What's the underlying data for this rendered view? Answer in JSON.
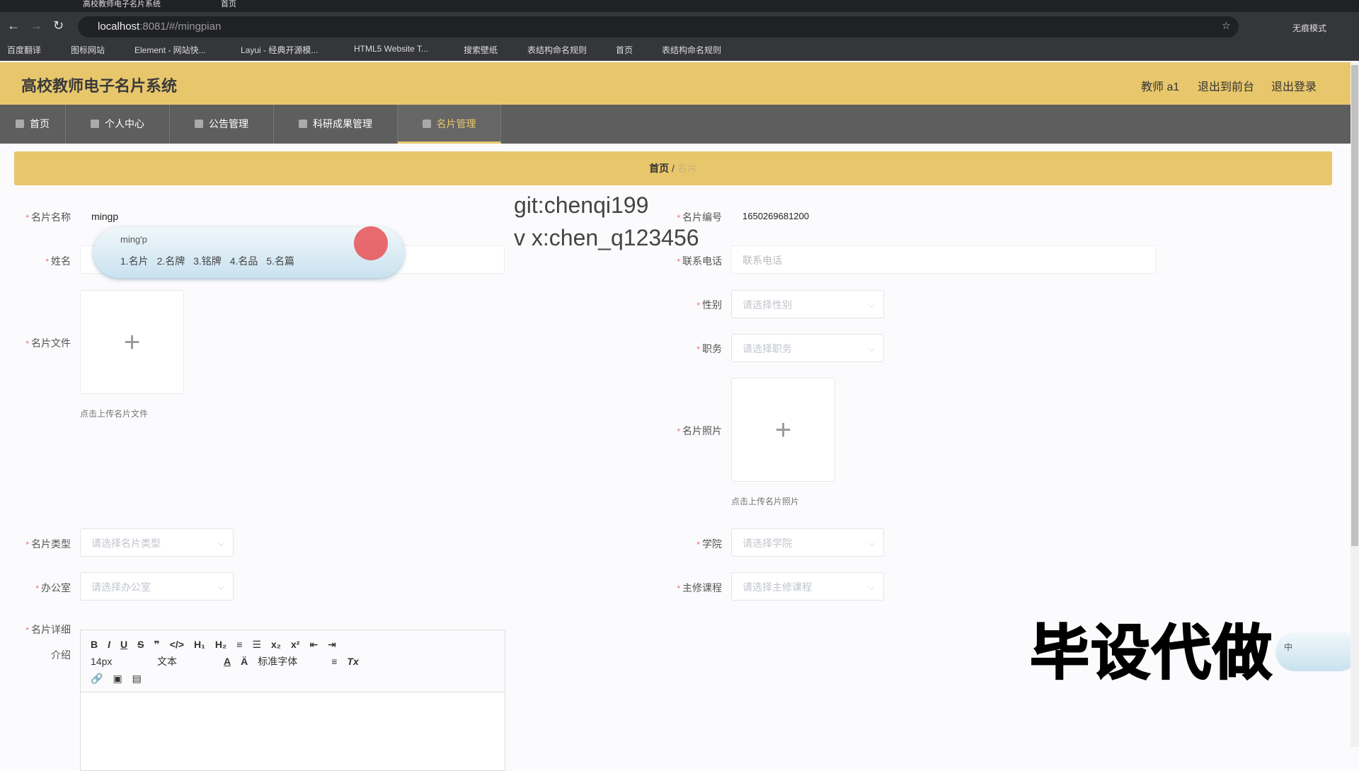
{
  "browser": {
    "tabs": [
      "高校教师电子名片系统",
      "首页"
    ],
    "url_host": "localhost",
    "url_rest": ":8081/#/mingpian",
    "profile": "无痕模式",
    "bookmarks": [
      "百度翻译",
      "图标网站",
      "Element - 网站快...",
      "Layui - 经典开源模...",
      "HTML5 Website T...",
      "搜索壁纸",
      "表结构命名规则",
      "首页",
      "表结构命名规则"
    ]
  },
  "header": {
    "title": "高校教师电子名片系统",
    "user": "教师 a1",
    "to_front": "退出到前台",
    "logout": "退出登录"
  },
  "nav": [
    "首页",
    "个人中心",
    "公告管理",
    "科研成果管理",
    "名片管理"
  ],
  "breadcrumb": {
    "home": "首页",
    "sep": "/",
    "current": "名片"
  },
  "form": {
    "name_label": "名片名称",
    "name_value": "mingp",
    "xingming_label": "姓名",
    "file_label": "名片文件",
    "file_hint": "点击上传名片文件",
    "type_label": "名片类型",
    "type_ph": "请选择名片类型",
    "office_label": "办公室",
    "office_ph": "请选择办公室",
    "detail_label": "名片详细",
    "detail_label2": "介绍",
    "no_label": "名片编号",
    "no_value": "1650269681200",
    "phone_label": "联系电话",
    "phone_ph": "联系电话",
    "gender_label": "性别",
    "gender_ph": "请选择性别",
    "duty_label": "职务",
    "duty_ph": "请选择职务",
    "photo_label": "名片照片",
    "photo_hint": "点击上传名片照片",
    "college_label": "学院",
    "college_ph": "请选择学院",
    "course_label": "主修课程",
    "course_ph": "请选择主修课程",
    "plus": "+"
  },
  "editor": {
    "size": "14px",
    "text": "文本",
    "font": "标准字体"
  },
  "ime": {
    "pinyin": "ming'p",
    "candidates": "1.名片 2.名牌 3.铭牌 4.名品 5.名篇",
    "mode": "中"
  },
  "overlay": {
    "git": "git:chenqi199",
    "vx": "v x:chen_q123456",
    "big": "毕设代做"
  }
}
